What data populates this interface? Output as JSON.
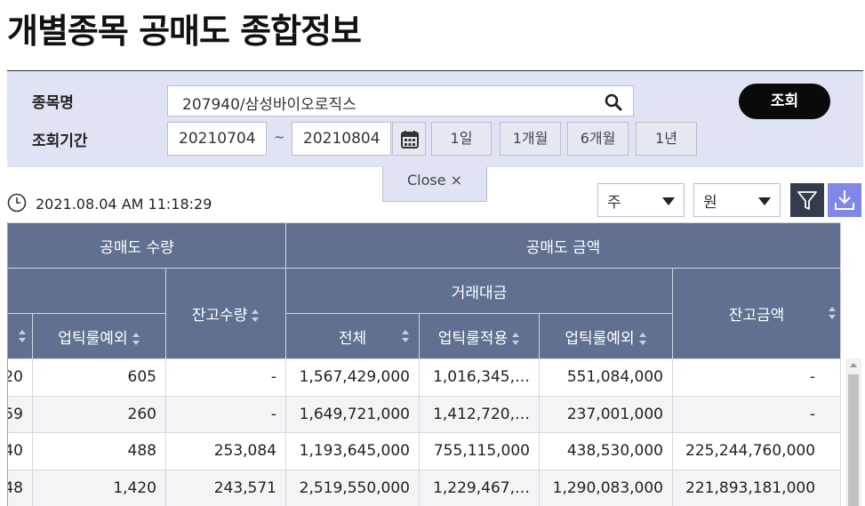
{
  "page": {
    "title": "개별종목 공매도 종합정보"
  },
  "search": {
    "stock_label": "종목명",
    "stock_value": "207940/삼성바이오로직스",
    "period_label": "조회기간",
    "start_date": "20210704",
    "tilde": "~",
    "end_date": "20210804",
    "query_button": "조회",
    "periods": [
      "1일",
      "1개월",
      "6개월",
      "1년"
    ],
    "close_label": "Close  ×"
  },
  "toolbar": {
    "timestamp": "2021.08.04 AM 11:18:29",
    "unit_period": "주",
    "unit_currency": "원"
  },
  "table": {
    "group_headers": {
      "quantity": "공매도 수량",
      "amount": "공매도 금액"
    },
    "sub_headers": {
      "trade_amount": "거래대금",
      "balance_qty": "잔고수량",
      "balance_amt": "잔고금액"
    },
    "leaf_headers": {
      "uptick_exempt_qty": "업틱룰예외",
      "total": "전체",
      "uptick_applied": "업틱룰적용",
      "uptick_exempt": "업틱룰예외"
    },
    "rows": [
      {
        "c0": "20",
        "c1": "605",
        "c2": "-",
        "c3": "1,567,429,000",
        "c4": "1,016,345,…",
        "c5": "551,084,000",
        "c6": "-"
      },
      {
        "c0": "59",
        "c1": "260",
        "c2": "-",
        "c3": "1,649,721,000",
        "c4": "1,412,720,…",
        "c5": "237,001,000",
        "c6": "-"
      },
      {
        "c0": "40",
        "c1": "488",
        "c2": "253,084",
        "c3": "1,193,645,000",
        "c4": "755,115,000",
        "c5": "438,530,000",
        "c6": "225,244,760,000"
      },
      {
        "c0": "48",
        "c1": "1,420",
        "c2": "243,571",
        "c3": "2,519,550,000",
        "c4": "1,229,467,…",
        "c5": "1,290,083,000",
        "c6": "221,893,181,000"
      }
    ]
  }
}
